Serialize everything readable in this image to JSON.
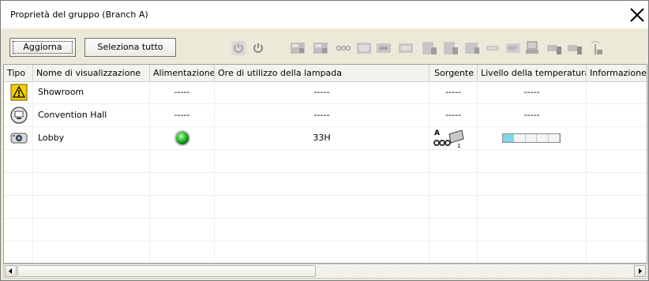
{
  "window": {
    "title": "Proprietà del gruppo (Branch A)"
  },
  "toolbar": {
    "refresh_label": "Aggiorna",
    "select_all_label": "Seleziona tutto",
    "icons": [
      "power-off",
      "power-on",
      "source-computer1",
      "source-computer2",
      "source-video",
      "source-s-video",
      "source-hdmi",
      "source-dvi",
      "source-input1",
      "source-input2",
      "source-network",
      "source-usb",
      "source-lan",
      "source-wireless-1",
      "source-wireless-2",
      "antenna"
    ]
  },
  "grid": {
    "columns": [
      "Tipo",
      "Nome di visualizzazione",
      "Alimentazione",
      "Ore di utilizzo della lampada",
      "Sorgente",
      "Livello della temperatura",
      "Informazione s"
    ],
    "rows": [
      {
        "type_icon": "warning-icon",
        "name": "Showroom",
        "power": "-----",
        "lamp_hours": "-----",
        "source": "-----",
        "temperature": "-----"
      },
      {
        "type_icon": "monitor-icon",
        "name": "Convention Hall",
        "power": "-----",
        "lamp_hours": "-----",
        "source": "-----",
        "temperature": "-----"
      },
      {
        "type_icon": "projector-icon",
        "name": "Lobby",
        "power": "on",
        "lamp_hours": "33H",
        "source": "A",
        "temperature_level": 0.2
      }
    ]
  },
  "colors": {
    "accent_cyan": "#7fd6e6",
    "power_green": "#2fbf2f"
  }
}
